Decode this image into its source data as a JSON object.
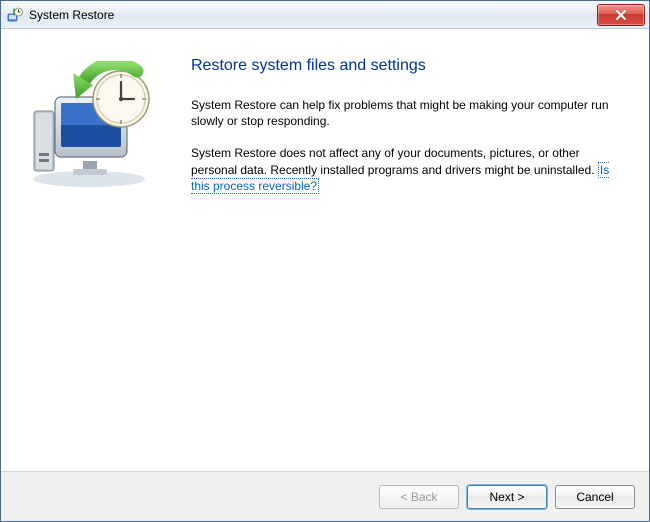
{
  "window": {
    "title": "System Restore"
  },
  "content": {
    "heading": "Restore system files and settings",
    "paragraph1": "System Restore can help fix problems that might be making your computer run slowly or stop responding.",
    "paragraph2_lead": "System Restore does not affect any of your documents, pictures, or other personal data. Recently installed programs and drivers might be uninstalled. ",
    "reversible_link": "Is this process reversible?"
  },
  "footer": {
    "back_label": "< Back",
    "next_label": "Next >",
    "cancel_label": "Cancel"
  }
}
